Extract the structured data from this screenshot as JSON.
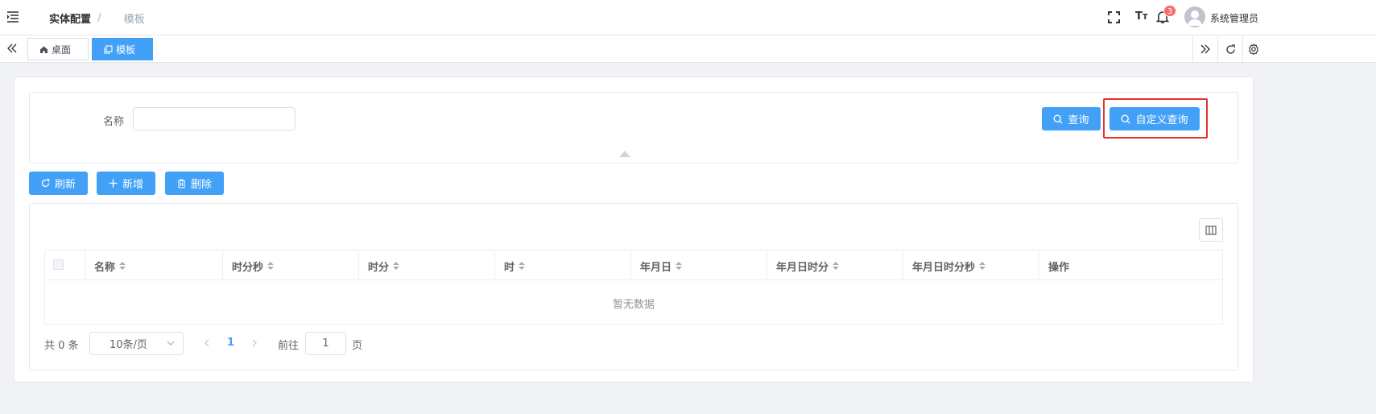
{
  "header": {
    "breadcrumb": [
      "实体配置",
      "模板"
    ],
    "breadcrumb_separator": "/",
    "notification_count": "3",
    "username": "系统管理员"
  },
  "tags": [
    {
      "label": "桌面",
      "icon": "home-icon",
      "active": false
    },
    {
      "label": "模板",
      "icon": "copy-icon",
      "active": true
    }
  ],
  "search": {
    "name_label": "名称",
    "name_value": "",
    "query_button": "查询",
    "custom_query_button": "自定义查询"
  },
  "toolbar": {
    "refresh": "刷新",
    "add": "新增",
    "delete": "删除"
  },
  "table": {
    "columns": [
      "名称",
      "时分秒",
      "时分",
      "时",
      "年月日",
      "年月日时分",
      "年月日时分秒",
      "操作"
    ],
    "empty_text": "暂无数据"
  },
  "pagination": {
    "total_text": "共 0 条",
    "page_size": "10条/页",
    "current_page": "1",
    "goto_label": "前往",
    "goto_value": "1",
    "page_suffix": "页"
  },
  "colors": {
    "primary": "#42a1f7",
    "highlight_border": "#e5312c",
    "badge": "#f56c6c"
  }
}
